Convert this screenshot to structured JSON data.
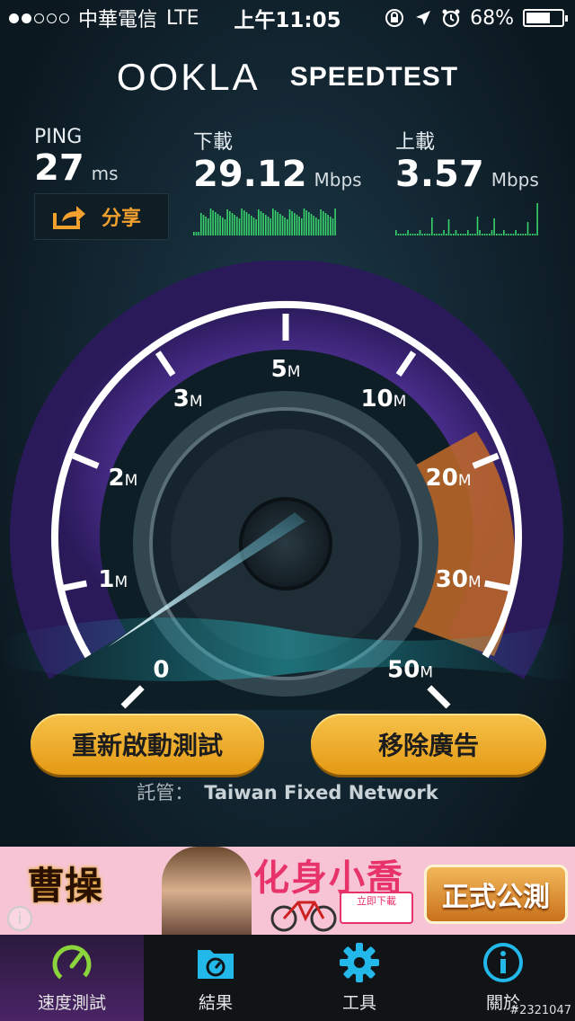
{
  "status_bar": {
    "carrier": "中華電信",
    "network": "LTE",
    "time": "上午11:05",
    "battery": "68%",
    "battery_level": 0.68
  },
  "header": {
    "logo": "OOKLA",
    "title": "SPEEDTEST"
  },
  "metrics": {
    "ping": {
      "label": "PING",
      "value": "27",
      "unit": "ms"
    },
    "download": {
      "label": "下載",
      "value": "29.12",
      "unit": "Mbps"
    },
    "upload": {
      "label": "上載",
      "value": "3.57",
      "unit": "Mbps"
    }
  },
  "share": {
    "label": "分享"
  },
  "gauge": {
    "tick_labels": [
      "0",
      "1",
      "2",
      "3",
      "5",
      "10",
      "20",
      "30",
      "50"
    ],
    "unit_suffix": "M",
    "needle_value": 0.6,
    "accent_colors": {
      "purple": "#5a3aa0",
      "orange": "#e8892e",
      "cyan": "#5fe0ff"
    }
  },
  "buttons": {
    "restart": "重新啟動測試",
    "remove_ads": "移除廣告"
  },
  "host": {
    "label": "託管：",
    "name": "Taiwan Fixed Network"
  },
  "ad": {
    "logo": "曹操",
    "title": "化身小喬",
    "cta": "正式公測",
    "sub": "立即下載"
  },
  "tabbar": {
    "items": [
      {
        "label": "速度測試",
        "icon": "speedometer-icon",
        "active": true
      },
      {
        "label": "結果",
        "icon": "results-folder-icon",
        "active": false
      },
      {
        "label": "工具",
        "icon": "gear-icon",
        "active": false
      },
      {
        "label": "關於",
        "icon": "info-icon",
        "active": false
      }
    ]
  },
  "watermark": "#2321047",
  "colors": {
    "accent_orange": "#f2a02e",
    "button_gold": "#f0b43a",
    "spark_green": "#38d36a",
    "tab_active": "#4a2466",
    "icon_cyan": "#22b8ea",
    "icon_green": "#8bd43c"
  }
}
